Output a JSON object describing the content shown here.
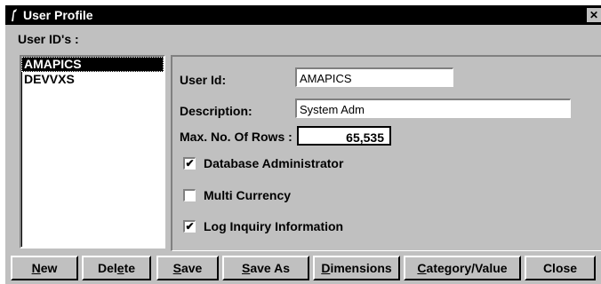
{
  "window": {
    "title": "User Profile",
    "close_glyph": "✕"
  },
  "user_ids": {
    "label": "User ID's :",
    "items": [
      "AMAPICS",
      "DEVVXS"
    ],
    "selected": "AMAPICS"
  },
  "form": {
    "user_id_label": "User Id:",
    "user_id_value": "AMAPICS",
    "description_label": "Description:",
    "description_value": "System Adm",
    "max_rows_label": "Max. No. Of Rows :",
    "max_rows_value": "65,535",
    "checkboxes": [
      {
        "label": "Database Administrator",
        "checked": true
      },
      {
        "label": "Multi Currency",
        "checked": false
      },
      {
        "label": "Log Inquiry Information",
        "checked": true
      }
    ]
  },
  "buttons": [
    {
      "label": "New",
      "accel": "N",
      "rest": "ew"
    },
    {
      "label": "Delete",
      "pre": "Del",
      "accel": "e",
      "rest": "te"
    },
    {
      "label": "Save",
      "accel": "S",
      "rest": "ave"
    },
    {
      "label": "Save As",
      "accel": "S",
      "rest": "ave As"
    },
    {
      "label": "Dimensions",
      "accel": "D",
      "rest": "imensions"
    },
    {
      "label": "Category/Value",
      "accel": "C",
      "rest": "ategory/Value"
    },
    {
      "label": "Close",
      "accel": "",
      "rest": "Close"
    }
  ],
  "icons": {
    "app": "app-icon",
    "check": "✔"
  }
}
